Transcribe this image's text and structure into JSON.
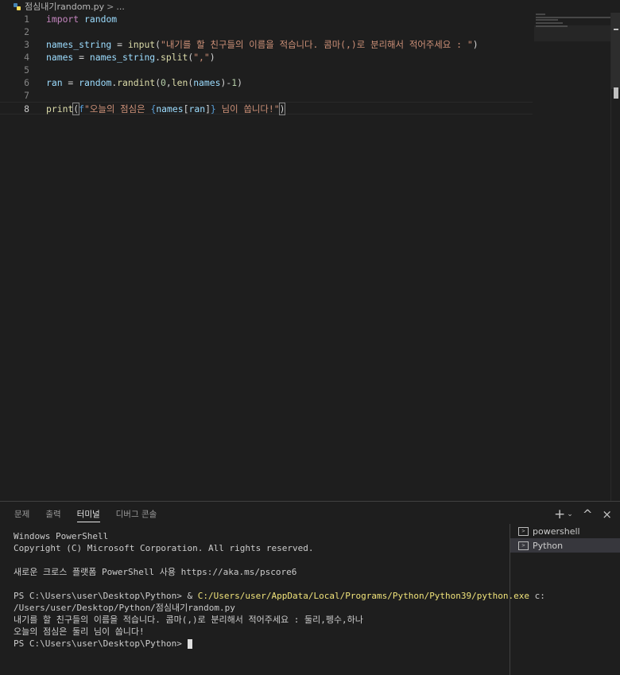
{
  "breadcrumb": {
    "file": "점심내기random.py",
    "sep": ">",
    "more": "..."
  },
  "editor": {
    "lines": [
      {
        "n": "1",
        "tokens": [
          {
            "t": "import",
            "c": "kw-import"
          },
          {
            "t": " "
          },
          {
            "t": "random",
            "c": "var"
          }
        ]
      },
      {
        "n": "2",
        "tokens": []
      },
      {
        "n": "3",
        "tokens": [
          {
            "t": "names_string",
            "c": "var"
          },
          {
            "t": " = "
          },
          {
            "t": "input",
            "c": "fn"
          },
          {
            "t": "("
          },
          {
            "t": "\"내기를 할 친구들의 이름을 적습니다. 콤마(,)로 분리해서 적어주세요 : \"",
            "c": "str"
          },
          {
            "t": ")"
          }
        ]
      },
      {
        "n": "4",
        "tokens": [
          {
            "t": "names",
            "c": "var"
          },
          {
            "t": " = "
          },
          {
            "t": "names_string",
            "c": "var"
          },
          {
            "t": "."
          },
          {
            "t": "split",
            "c": "fn"
          },
          {
            "t": "("
          },
          {
            "t": "\",\"",
            "c": "str"
          },
          {
            "t": ")"
          }
        ]
      },
      {
        "n": "5",
        "tokens": []
      },
      {
        "n": "6",
        "tokens": [
          {
            "t": "ran",
            "c": "var"
          },
          {
            "t": " = "
          },
          {
            "t": "random",
            "c": "var"
          },
          {
            "t": "."
          },
          {
            "t": "randint",
            "c": "fn"
          },
          {
            "t": "("
          },
          {
            "t": "0",
            "c": "num"
          },
          {
            "t": ","
          },
          {
            "t": "len",
            "c": "fn"
          },
          {
            "t": "("
          },
          {
            "t": "names",
            "c": "var"
          },
          {
            "t": ")-"
          },
          {
            "t": "1",
            "c": "num"
          },
          {
            "t": ")"
          }
        ]
      },
      {
        "n": "7",
        "tokens": []
      },
      {
        "n": "8",
        "tokens": [
          {
            "t": "print",
            "c": "fn"
          },
          {
            "t": "(",
            "c": "bracket-hl"
          },
          {
            "t": "f",
            "c": "fpre"
          },
          {
            "t": "\"오늘의 점심은 ",
            "c": "str"
          },
          {
            "t": "{",
            "c": "brace"
          },
          {
            "t": "names",
            "c": "var"
          },
          {
            "t": "["
          },
          {
            "t": "ran",
            "c": "var"
          },
          {
            "t": "]"
          },
          {
            "t": "}",
            "c": "brace"
          },
          {
            "t": " 님이 쏩니다!\"",
            "c": "str"
          },
          {
            "t": ")",
            "c": "bracket-hl"
          }
        ],
        "current": true
      }
    ]
  },
  "panel": {
    "tabs": [
      {
        "label": "문제"
      },
      {
        "label": "출력"
      },
      {
        "label": "터미널",
        "active": true
      },
      {
        "label": "디버그 콘솔"
      }
    ],
    "actions": {
      "add": "+",
      "dropdown": "⌄",
      "maximize": "^",
      "close": "×"
    }
  },
  "terminal": {
    "l1": "Windows PowerShell",
    "l2": "Copyright (C) Microsoft Corporation. All rights reserved.",
    "l3": "새로운 크로스 플랫폼 PowerShell 사용 https://aka.ms/pscore6",
    "prompt": "PS C:\\Users\\user\\Desktop\\Python> & ",
    "exe": "C:/Users/user/AppData/Local/Programs/Python/Python39/python.exe",
    "arg": " c:",
    "l5": "/Users/user/Desktop/Python/점심내기random.py",
    "l6": "내기를 할 친구들의 이름을 적습니다. 콤마(,)로 분리해서 적어주세요 : 둘리,펭수,하나",
    "l7": "오늘의 점심은 둘리 님이 쏩니다!",
    "l8": "PS C:\\Users\\user\\Desktop\\Python> "
  },
  "terminals": [
    {
      "name": "powershell"
    },
    {
      "name": "Python",
      "selected": true
    }
  ]
}
